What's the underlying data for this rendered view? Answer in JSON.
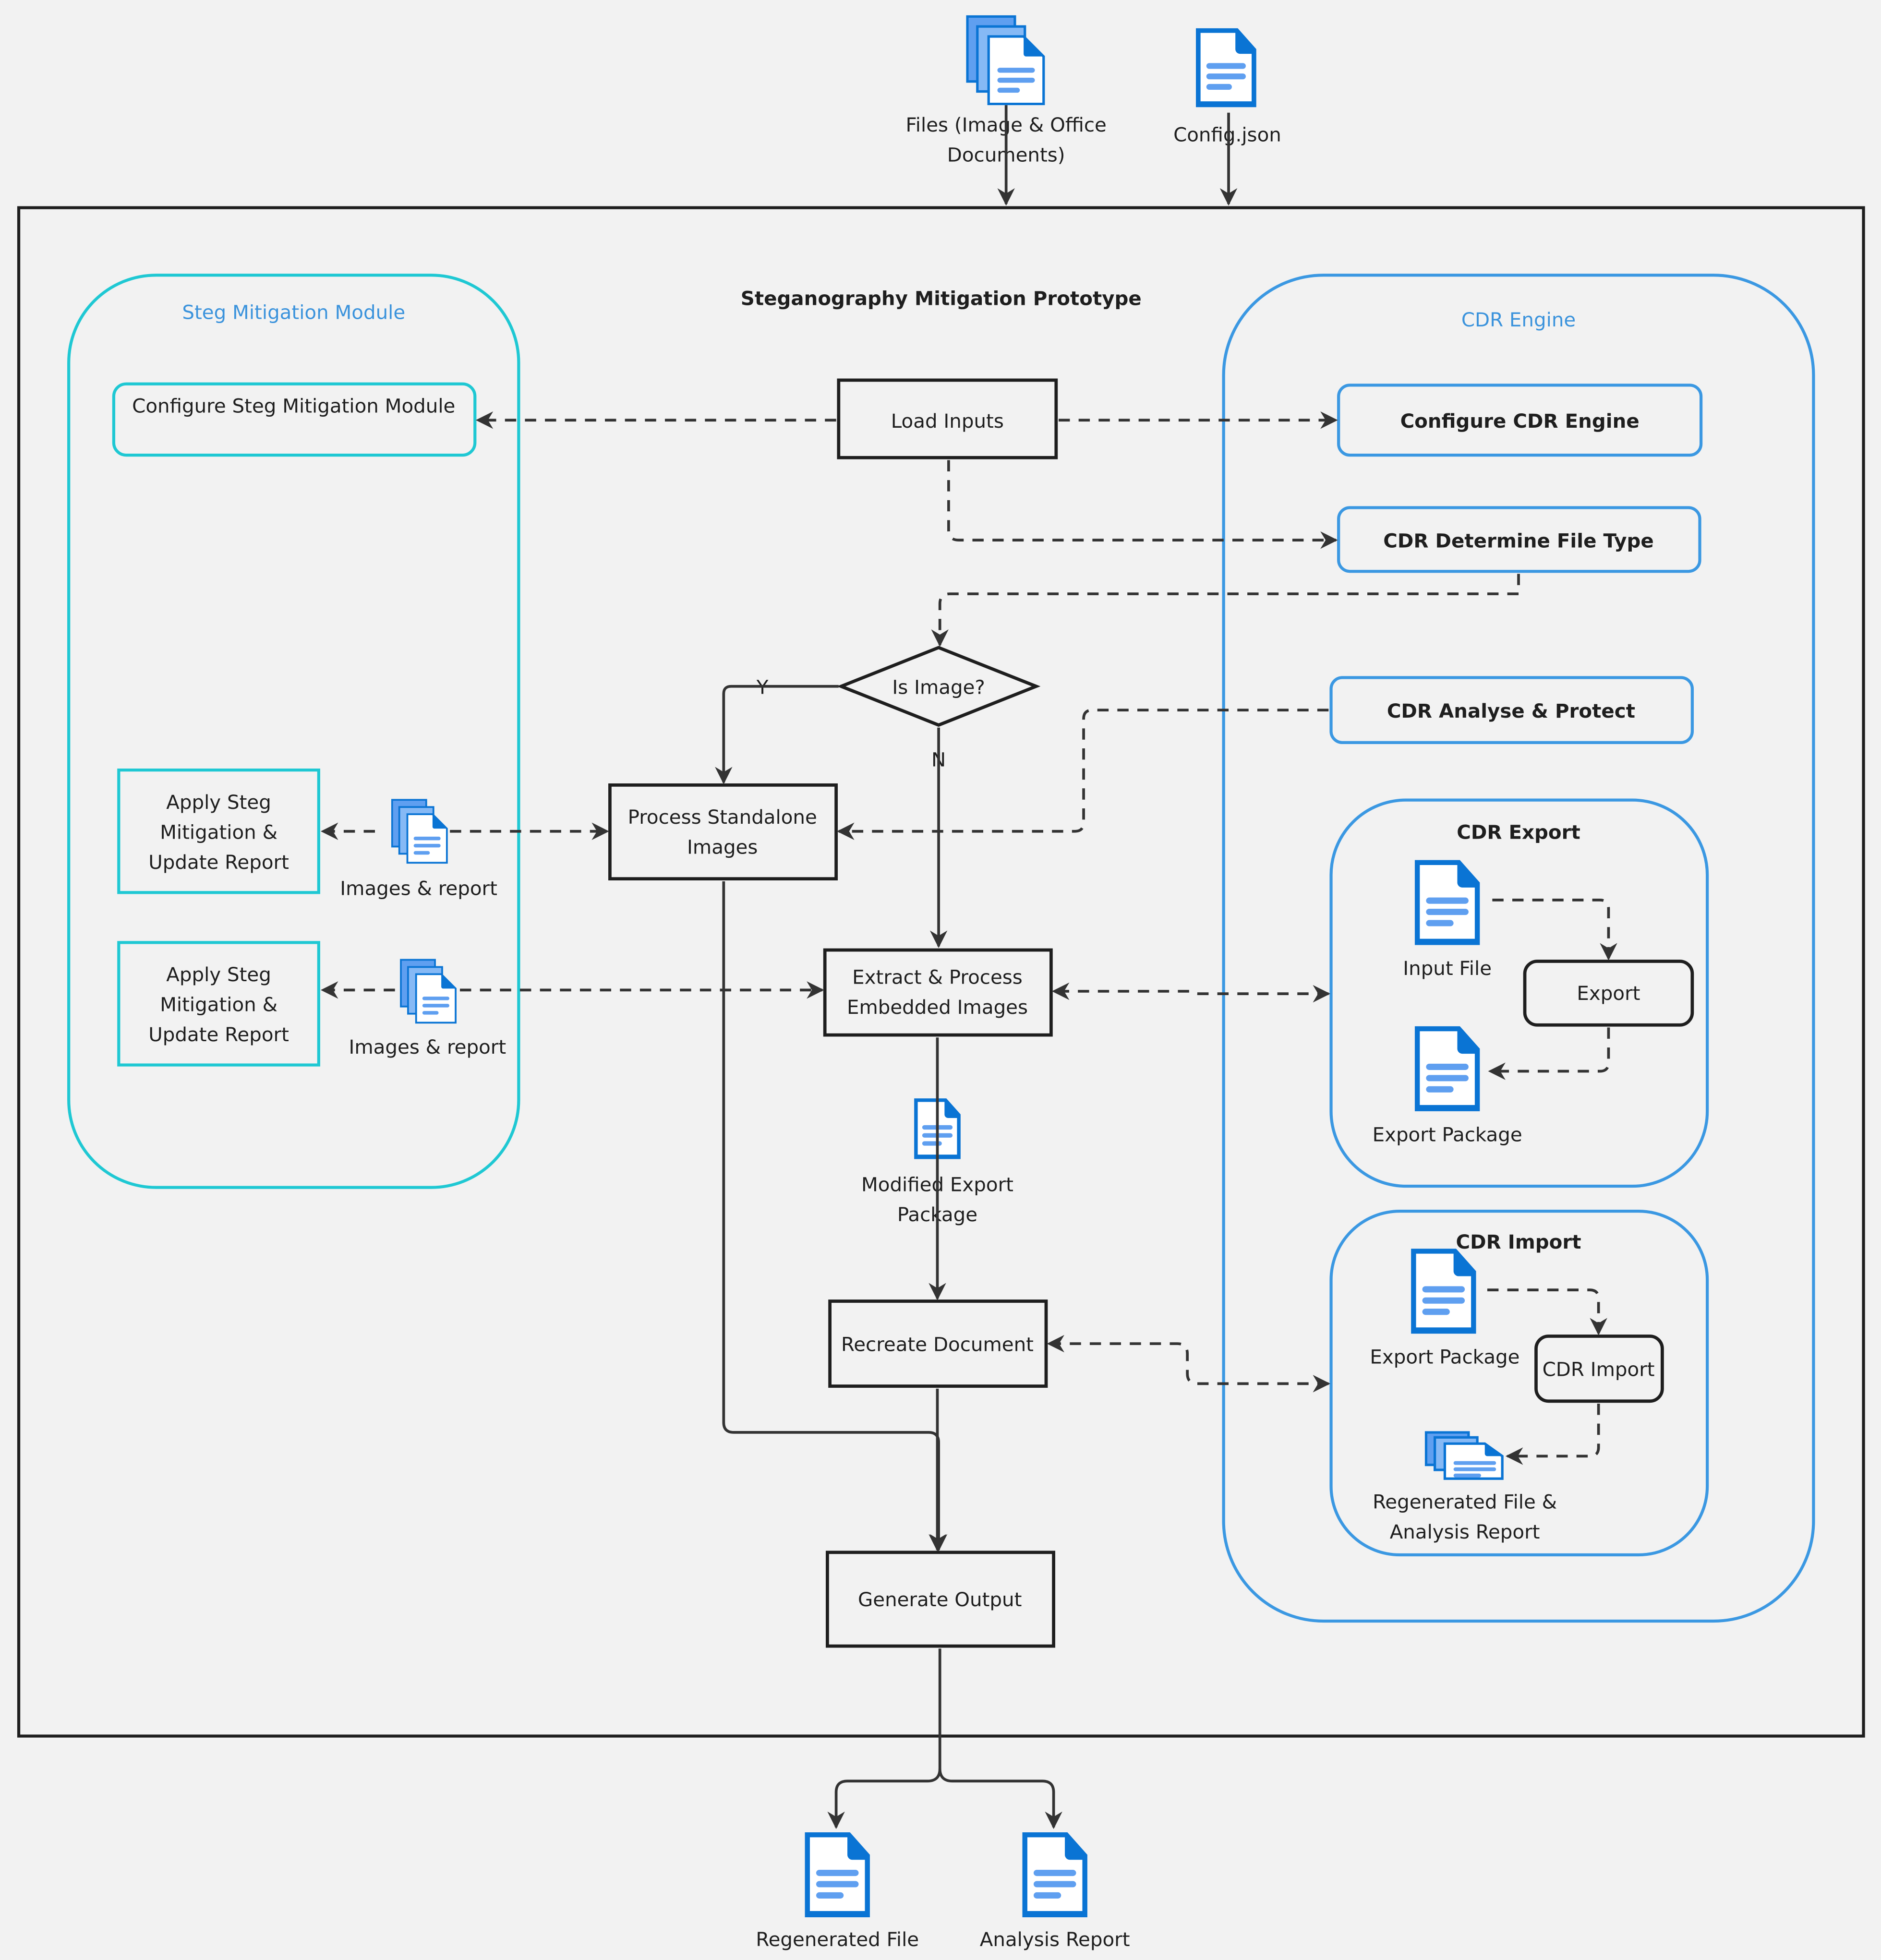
{
  "diagram": {
    "title": "Steganography Mitigation Prototype",
    "inputs": {
      "files": [
        "Files (Image & Office",
        "Documents)"
      ],
      "config": "Config.json"
    },
    "steg_module": {
      "title": "Steg Mitigation Module",
      "configure": "Configure Steg Mitigation Module",
      "apply_1": [
        "Apply Steg",
        "Mitigation &",
        "Update Report"
      ],
      "apply_2": [
        "Apply Steg",
        "Mitigation &",
        "Update Report"
      ]
    },
    "flow": {
      "load_inputs": "Load Inputs",
      "is_image": "Is Image?",
      "yes": "Y",
      "no": "N",
      "process_standalone": [
        "Process Standalone",
        "Images"
      ],
      "extract_process": [
        "Extract & Process",
        "Embedded Images"
      ],
      "modified_export": [
        "Modified Export",
        "Package"
      ],
      "recreate": "Recreate Document",
      "generate": "Generate Output",
      "images_report_1": "Images & report",
      "images_report_2": "Images & report"
    },
    "cdr_engine": {
      "title": "CDR Engine",
      "configure": "Configure CDR Engine",
      "determine": "CDR Determine  File Type",
      "analyse": "CDR Analyse & Protect",
      "export": {
        "title": "CDR Export",
        "input_file": "Input File",
        "action": "Export",
        "output": "Export Package"
      },
      "import": {
        "title": "CDR Import",
        "input": "Export Package",
        "action": "CDR Import",
        "output": [
          "Regenerated File &",
          "Analysis Report"
        ]
      }
    },
    "outputs": {
      "regenerated": "Regenerated File",
      "report": "Analysis Report"
    }
  },
  "colors": {
    "teal": "#1fc8d3",
    "blue": "#3b98e2",
    "doc_blue": "#0a74d4",
    "doc_line": "#5f9ff0",
    "line": "#333333"
  }
}
